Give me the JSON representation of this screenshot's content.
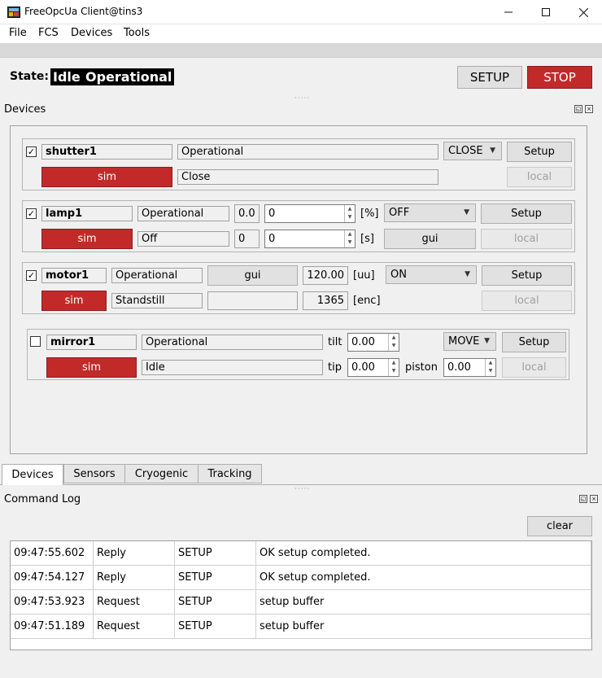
{
  "window": {
    "title": "FreeOpcUa Client@tins3"
  },
  "menu": [
    "File",
    "FCS",
    "Devices",
    "Tools"
  ],
  "state": {
    "label": "State:",
    "value1": "Idle",
    "value2": "Operational",
    "setup_label": "SETUP",
    "stop_label": "STOP"
  },
  "devices_dock": {
    "title": "Devices"
  },
  "shutter": {
    "checked": true,
    "name": "shutter1",
    "status": "Operational",
    "mode": "CLOSE",
    "setup": "Setup",
    "sim": "sim",
    "state": "Close",
    "local": "local"
  },
  "lamp": {
    "checked": true,
    "name": "lamp1",
    "status": "Operational",
    "val_readback": "0.0",
    "val_input": "0",
    "val_unit": "[%]",
    "mode": "OFF",
    "setup": "Setup",
    "sim": "sim",
    "state": "Off",
    "time_readback": "0",
    "time_input": "0",
    "time_unit": "[s]",
    "gui": "gui",
    "local": "local"
  },
  "motor": {
    "checked": true,
    "name": "motor1",
    "status": "Operational",
    "gui": "gui",
    "position": "120.00",
    "pos_unit": "[uu]",
    "mode": "ON",
    "setup": "Setup",
    "sim": "sim",
    "state": "Standstill",
    "encoder": "1365",
    "enc_unit": "[enc]",
    "local": "local"
  },
  "mirror": {
    "checked": false,
    "name": "mirror1",
    "status": "Operational",
    "tilt_label": "tilt",
    "tilt": "0.00",
    "mode": "MOVE",
    "setup": "Setup",
    "sim": "sim",
    "state": "Idle",
    "tip_label": "tip",
    "tip": "0.00",
    "piston_label": "piston",
    "piston": "0.00",
    "local": "local"
  },
  "tabs": [
    "Devices",
    "Sensors",
    "Cryogenic",
    "Tracking"
  ],
  "log_dock": {
    "title": "Command Log",
    "clear_label": "clear"
  },
  "log_rows": [
    {
      "time": "09:47:55.602",
      "type": "Reply",
      "cmd": "SETUP",
      "msg": "OK setup completed."
    },
    {
      "time": "09:47:54.127",
      "type": "Reply",
      "cmd": "SETUP",
      "msg": "OK setup completed."
    },
    {
      "time": "09:47:53.923",
      "type": "Request",
      "cmd": "SETUP",
      "msg": "setup buffer"
    },
    {
      "time": "09:47:51.189",
      "type": "Request",
      "cmd": "SETUP",
      "msg": "setup buffer"
    }
  ],
  "colors": {
    "sim_red": "#c22a2a",
    "stop_red": "#c22a2a"
  },
  "icons": {
    "minimize": "minimize-icon",
    "maximize": "maximize-icon",
    "close": "close-icon"
  }
}
